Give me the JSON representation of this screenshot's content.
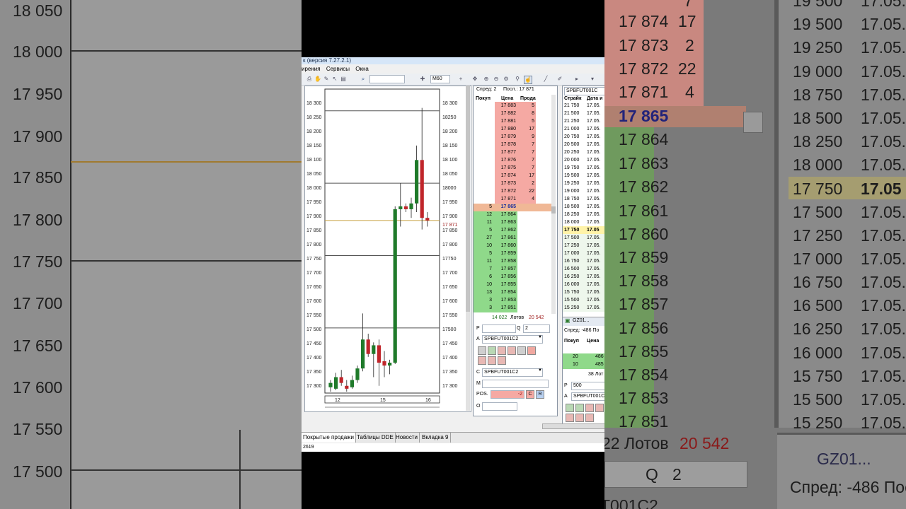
{
  "app": {
    "title": "к (версия 7.27.2.1)",
    "menu": [
      "ирения",
      "Сервисы",
      "Окна"
    ],
    "timeframe": "M60"
  },
  "left_bg": {
    "prices": [
      "18 050",
      "18 000",
      "17 950",
      "17 900",
      "17 850",
      "17 800",
      "17 750",
      "17 700",
      "17 650",
      "17 600",
      "17 550",
      "17 500"
    ]
  },
  "right_bg": {
    "col1": [
      "17 874",
      "17 873",
      "17 872",
      "17 871",
      "17 865",
      "17 864",
      "17 863",
      "17 862",
      "17 861",
      "17 860",
      "17 859",
      "17 858",
      "17 857",
      "17 856",
      "17 855",
      "17 854",
      "17 853",
      "17 851"
    ],
    "bid_col": [
      "7",
      "17",
      "2",
      "22",
      "4"
    ],
    "strikes": [
      "19 500",
      "19 500",
      "19 250",
      "19 000",
      "18 750",
      "18 500",
      "18 250",
      "18 000",
      "17 750",
      "17 500",
      "17 250",
      "17 000",
      "16 750",
      "16 500",
      "16 250",
      "16 000",
      "15 750",
      "15 500",
      "15 250"
    ],
    "dates": [
      "17.05.",
      "17.05.",
      "17.05.",
      "17.05.",
      "17.05.",
      "17.05.",
      "17.05.",
      "17.05.",
      "17.05",
      "17.05.",
      "17.05.",
      "17.05.",
      "17.05.",
      "17.05.",
      "17.05.",
      "17.05.",
      "17.05.",
      "17.05.",
      "17.05."
    ],
    "lots": "22 Лотов",
    "lots_value": "20 542",
    "q_label": "Q",
    "q_value": "2",
    "gz_label": "GZ01...",
    "spread": "Спред: -486 Пос",
    "instrument": "T001C2"
  },
  "chart": {
    "y_ticks": [
      "18 300",
      "18 250",
      "18 200",
      "18 150",
      "18 100",
      "18 050",
      "18 000",
      "17 950",
      "17 900",
      "17 850",
      "17 800",
      "17 750",
      "17 700",
      "17 650",
      "17 600",
      "17 550",
      "17 500",
      "17 450",
      "17 400",
      "17 350",
      "17 300"
    ],
    "right_ticks": [
      "18 300",
      "18250",
      "18 200",
      "18 150",
      "18 100",
      "18 050",
      "18000",
      "17 950",
      "17 900",
      "17 871",
      "17 850",
      "17 800",
      "17750",
      "17 700",
      "17 650",
      "17 600",
      "17 550",
      "17500",
      "17 450",
      "17 400",
      "17 350",
      "17 300"
    ],
    "x_ticks": [
      "12",
      "15",
      "16"
    ]
  },
  "chart_data": {
    "type": "candlestick",
    "y_range": [
      17275,
      18325
    ],
    "levels": [
      18250,
      18000,
      17750,
      17500
    ],
    "last_price": 17871,
    "candles": [
      {
        "o": 17295,
        "h": 17320,
        "l": 17280,
        "c": 17310
      },
      {
        "o": 17290,
        "h": 17345,
        "l": 17285,
        "c": 17330
      },
      {
        "o": 17330,
        "h": 17355,
        "l": 17300,
        "c": 17310
      },
      {
        "o": 17300,
        "h": 17320,
        "l": 17280,
        "c": 17290
      },
      {
        "o": 17295,
        "h": 17335,
        "l": 17290,
        "c": 17320
      },
      {
        "o": 17320,
        "h": 17370,
        "l": 17310,
        "c": 17360
      },
      {
        "o": 17360,
        "h": 17550,
        "l": 17350,
        "c": 17460
      },
      {
        "o": 17460,
        "h": 17480,
        "l": 17400,
        "c": 17410
      },
      {
        "o": 17410,
        "h": 17450,
        "l": 17330,
        "c": 17440
      },
      {
        "o": 17440,
        "h": 17460,
        "l": 17300,
        "c": 17380
      },
      {
        "o": 17385,
        "h": 17420,
        "l": 17330,
        "c": 17370
      },
      {
        "o": 17370,
        "h": 17390,
        "l": 17340,
        "c": 17380
      },
      {
        "o": 17380,
        "h": 17920,
        "l": 17375,
        "c": 17910
      },
      {
        "o": 17910,
        "h": 18000,
        "l": 17850,
        "c": 17920
      },
      {
        "o": 17920,
        "h": 17930,
        "l": 17900,
        "c": 17910
      },
      {
        "o": 17910,
        "h": 17950,
        "l": 17880,
        "c": 17930
      },
      {
        "o": 17930,
        "h": 18130,
        "l": 17900,
        "c": 18080
      },
      {
        "o": 18080,
        "h": 18260,
        "l": 17840,
        "c": 17880
      },
      {
        "o": 17880,
        "h": 17900,
        "l": 17850,
        "c": 17871
      }
    ]
  },
  "orderbook": {
    "spread_label": "Спред: 2",
    "last_label": "Посл.: 17 871",
    "headers": {
      "bid": "Покуп",
      "price": "Цена",
      "ask": "Прода"
    },
    "asks": [
      {
        "price": "17 883",
        "qty": "5"
      },
      {
        "price": "17 882",
        "qty": "8"
      },
      {
        "price": "17 881",
        "qty": "5"
      },
      {
        "price": "17 880",
        "qty": "17"
      },
      {
        "price": "17 879",
        "qty": "9"
      },
      {
        "price": "17 878",
        "qty": "7"
      },
      {
        "price": "17 877",
        "qty": "7"
      },
      {
        "price": "17 876",
        "qty": "7"
      },
      {
        "price": "17 875",
        "qty": "7"
      },
      {
        "price": "17 874",
        "qty": "17"
      },
      {
        "price": "17 873",
        "qty": "2"
      },
      {
        "price": "17 872",
        "qty": "22"
      },
      {
        "price": "17 871",
        "qty": "4"
      }
    ],
    "own": {
      "qty": "5",
      "price": "17 865"
    },
    "bids": [
      {
        "qty": "12",
        "price": "17 864"
      },
      {
        "qty": "11",
        "price": "17 863"
      },
      {
        "qty": "5",
        "price": "17 862"
      },
      {
        "qty": "27",
        "price": "17 861"
      },
      {
        "qty": "10",
        "price": "17 860"
      },
      {
        "qty": "5",
        "price": "17 859"
      },
      {
        "qty": "11",
        "price": "17 858"
      },
      {
        "qty": "7",
        "price": "17 857"
      },
      {
        "qty": "6",
        "price": "17 856"
      },
      {
        "qty": "10",
        "price": "17 855"
      },
      {
        "qty": "13",
        "price": "17 854"
      },
      {
        "qty": "3",
        "price": "17 853"
      },
      {
        "qty": "3",
        "price": "17 851"
      }
    ],
    "totals": {
      "bid": "14 022",
      "label": "Лотов",
      "ask": "20 542"
    },
    "p_label": "P",
    "q_label": "Q",
    "q_value": "2",
    "a_label": "A",
    "instrument_a": "SPBFUT001C2",
    "c_label": "C",
    "instrument_c": "SPBFUT001C2",
    "m_label": "M",
    "pos_label": "POS.",
    "pos_value": "-2",
    "o_label": "O",
    "btn_c": "C",
    "btn_r": "R"
  },
  "options": {
    "instrument": "SPBFUT001C",
    "headers": {
      "strike": "Страйк",
      "date": "Дата и"
    },
    "rows": [
      {
        "strike": "21 750",
        "date": "17.05."
      },
      {
        "strike": "21 500",
        "date": "17.05."
      },
      {
        "strike": "21 250",
        "date": "17.05."
      },
      {
        "strike": "21 000",
        "date": "17.05."
      },
      {
        "strike": "20 750",
        "date": "17.05."
      },
      {
        "strike": "20 500",
        "date": "17.05."
      },
      {
        "strike": "20 250",
        "date": "17.05."
      },
      {
        "strike": "20 000",
        "date": "17.05."
      },
      {
        "strike": "19 750",
        "date": "17.05."
      },
      {
        "strike": "19 500",
        "date": "17.05."
      },
      {
        "strike": "19 250",
        "date": "17.05."
      },
      {
        "strike": "19 000",
        "date": "17.05."
      },
      {
        "strike": "18 750",
        "date": "17.05."
      },
      {
        "strike": "18 500",
        "date": "17.05."
      },
      {
        "strike": "18 250",
        "date": "17.05."
      },
      {
        "strike": "18 000",
        "date": "17.05."
      },
      {
        "strike": "17 750",
        "date": "17.05"
      },
      {
        "strike": "17 500",
        "date": "17.05."
      },
      {
        "strike": "17 250",
        "date": "17.05."
      },
      {
        "strike": "17 000",
        "date": "17.05."
      },
      {
        "strike": "16 750",
        "date": "17.05."
      },
      {
        "strike": "16 500",
        "date": "17.05."
      },
      {
        "strike": "16 250",
        "date": "17.05."
      },
      {
        "strike": "16 000",
        "date": "17.05."
      },
      {
        "strike": "15 750",
        "date": "17.05."
      },
      {
        "strike": "15 500",
        "date": "17.05."
      },
      {
        "strike": "15 250",
        "date": "17.05."
      }
    ],
    "gz_label": "GZ01...",
    "spread_label": "Спред: -486 По",
    "sub_headers": {
      "bid": "Покуп",
      "price": "Цена"
    },
    "sub_rows": [
      {
        "qty": "20",
        "price": "486"
      },
      {
        "qty": "10",
        "price": "485"
      }
    ],
    "sub_lots": "38 Лот",
    "p_label": "P",
    "p_value": "500",
    "a_label": "A"
  },
  "tabs": [
    "Покрытые продажи",
    "Таблицы DDE",
    "Новости",
    "Вкладка 9"
  ],
  "status": "2619"
}
